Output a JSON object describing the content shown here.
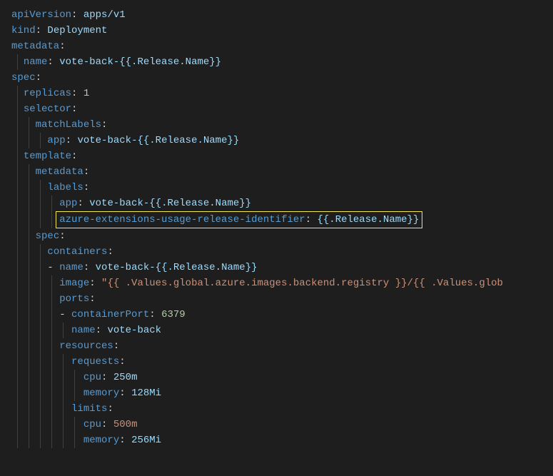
{
  "lines": [
    {
      "indent": 0,
      "guides": [],
      "segments": [
        [
          "key",
          "apiVersion"
        ],
        [
          "colon",
          ": "
        ],
        [
          "val-plain",
          "apps/v1"
        ]
      ]
    },
    {
      "indent": 0,
      "guides": [],
      "segments": [
        [
          "key",
          "kind"
        ],
        [
          "colon",
          ": "
        ],
        [
          "val-plain",
          "Deployment"
        ]
      ]
    },
    {
      "indent": 0,
      "guides": [],
      "segments": [
        [
          "key",
          "metadata"
        ],
        [
          "colon",
          ":"
        ]
      ]
    },
    {
      "indent": 2,
      "guides": [
        1
      ],
      "segments": [
        [
          "key",
          "name"
        ],
        [
          "colon",
          ": "
        ],
        [
          "val-template",
          "vote-back-{{.Release.Name}}"
        ]
      ]
    },
    {
      "indent": 0,
      "guides": [],
      "segments": [
        [
          "key",
          "spec"
        ],
        [
          "colon",
          ":"
        ]
      ]
    },
    {
      "indent": 2,
      "guides": [
        1
      ],
      "segments": [
        [
          "key",
          "replicas"
        ],
        [
          "colon",
          ": "
        ],
        [
          "val-num",
          "1"
        ]
      ]
    },
    {
      "indent": 2,
      "guides": [
        1
      ],
      "segments": [
        [
          "key",
          "selector"
        ],
        [
          "colon",
          ":"
        ]
      ]
    },
    {
      "indent": 4,
      "guides": [
        1,
        3
      ],
      "segments": [
        [
          "key",
          "matchLabels"
        ],
        [
          "colon",
          ":"
        ]
      ]
    },
    {
      "indent": 6,
      "guides": [
        1,
        3,
        5
      ],
      "segments": [
        [
          "key",
          "app"
        ],
        [
          "colon",
          ": "
        ],
        [
          "val-template",
          "vote-back-{{.Release.Name}}"
        ]
      ]
    },
    {
      "indent": 2,
      "guides": [
        1
      ],
      "segments": [
        [
          "key",
          "template"
        ],
        [
          "colon",
          ":"
        ]
      ]
    },
    {
      "indent": 4,
      "guides": [
        1,
        3
      ],
      "segments": [
        [
          "key",
          "metadata"
        ],
        [
          "colon",
          ":"
        ]
      ]
    },
    {
      "indent": 6,
      "guides": [
        1,
        3,
        5
      ],
      "segments": [
        [
          "key",
          "labels"
        ],
        [
          "colon",
          ":"
        ]
      ]
    },
    {
      "indent": 8,
      "guides": [
        1,
        3,
        5,
        7
      ],
      "segments": [
        [
          "key",
          "app"
        ],
        [
          "colon",
          ": "
        ],
        [
          "val-template",
          "vote-back-{{.Release.Name}}"
        ]
      ]
    },
    {
      "indent": 8,
      "guides": [
        1,
        3,
        5,
        7
      ],
      "highlight": true,
      "segments": [
        [
          "key",
          "azure-extensions-usage-release-identifier"
        ],
        [
          "colon",
          ": "
        ],
        [
          "val-template",
          "{{.Release.Name}}"
        ]
      ]
    },
    {
      "indent": 4,
      "guides": [
        1,
        3
      ],
      "segments": [
        [
          "key",
          "spec"
        ],
        [
          "colon",
          ":"
        ]
      ]
    },
    {
      "indent": 6,
      "guides": [
        1,
        3,
        5
      ],
      "segments": [
        [
          "key",
          "containers"
        ],
        [
          "colon",
          ":"
        ]
      ]
    },
    {
      "indent": 6,
      "guides": [
        1,
        3,
        5
      ],
      "segments": [
        [
          "dash",
          "- "
        ],
        [
          "key",
          "name"
        ],
        [
          "colon",
          ": "
        ],
        [
          "val-template",
          "vote-back-{{.Release.Name}}"
        ]
      ]
    },
    {
      "indent": 8,
      "guides": [
        1,
        3,
        5,
        7
      ],
      "segments": [
        [
          "key",
          "image"
        ],
        [
          "colon",
          ": "
        ],
        [
          "val-string",
          "\"{{ .Values.global.azure.images.backend.registry }}/{{ .Values.glob"
        ]
      ]
    },
    {
      "indent": 8,
      "guides": [
        1,
        3,
        5,
        7
      ],
      "segments": [
        [
          "key",
          "ports"
        ],
        [
          "colon",
          ":"
        ]
      ]
    },
    {
      "indent": 8,
      "guides": [
        1,
        3,
        5,
        7
      ],
      "segments": [
        [
          "dash",
          "- "
        ],
        [
          "key",
          "containerPort"
        ],
        [
          "colon",
          ": "
        ],
        [
          "val-num",
          "6379"
        ]
      ]
    },
    {
      "indent": 10,
      "guides": [
        1,
        3,
        5,
        7,
        9
      ],
      "segments": [
        [
          "key",
          "name"
        ],
        [
          "colon",
          ": "
        ],
        [
          "val-plain",
          "vote-back"
        ]
      ]
    },
    {
      "indent": 8,
      "guides": [
        1,
        3,
        5,
        7
      ],
      "segments": [
        [
          "key",
          "resources"
        ],
        [
          "colon",
          ":"
        ]
      ]
    },
    {
      "indent": 10,
      "guides": [
        1,
        3,
        5,
        7,
        9
      ],
      "segments": [
        [
          "key",
          "requests"
        ],
        [
          "colon",
          ":"
        ]
      ]
    },
    {
      "indent": 12,
      "guides": [
        1,
        3,
        5,
        7,
        9,
        11
      ],
      "segments": [
        [
          "key",
          "cpu"
        ],
        [
          "colon",
          ": "
        ],
        [
          "val-plain",
          "250m"
        ]
      ]
    },
    {
      "indent": 12,
      "guides": [
        1,
        3,
        5,
        7,
        9,
        11
      ],
      "segments": [
        [
          "key",
          "memory"
        ],
        [
          "colon",
          ": "
        ],
        [
          "val-plain",
          "128Mi"
        ]
      ]
    },
    {
      "indent": 10,
      "guides": [
        1,
        3,
        5,
        7,
        9
      ],
      "segments": [
        [
          "key",
          "limits"
        ],
        [
          "colon",
          ":"
        ]
      ]
    },
    {
      "indent": 12,
      "guides": [
        1,
        3,
        5,
        7,
        9,
        11
      ],
      "segments": [
        [
          "key",
          "cpu"
        ],
        [
          "colon",
          ": "
        ],
        [
          "val-string",
          "500m"
        ]
      ]
    },
    {
      "indent": 12,
      "guides": [
        1,
        3,
        5,
        7,
        9,
        11
      ],
      "segments": [
        [
          "key",
          "memory"
        ],
        [
          "colon",
          ": "
        ],
        [
          "val-plain",
          "256Mi"
        ]
      ]
    }
  ],
  "charWidth": 8
}
